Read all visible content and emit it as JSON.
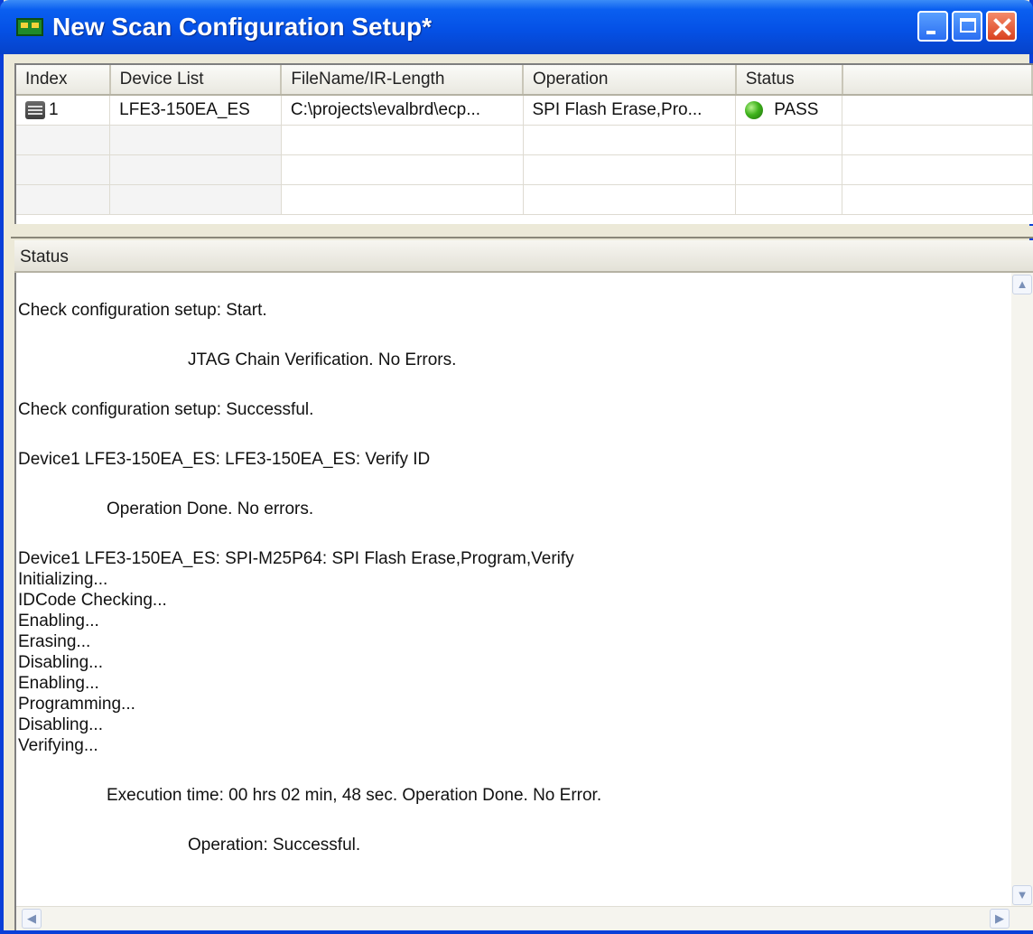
{
  "window": {
    "title": "New Scan Configuration Setup*"
  },
  "grid": {
    "columns": [
      "Index",
      "Device List",
      "FileName/IR-Length",
      "Operation",
      "Status"
    ],
    "rows": [
      {
        "index": "1",
        "device": "LFE3-150EA_ES",
        "file": "C:\\projects\\evalbrd\\ecp...",
        "operation": "SPI Flash Erase,Pro...",
        "status": "PASS"
      }
    ]
  },
  "status_panel": {
    "header": "Status",
    "lines": [
      "Check configuration setup: Start.",
      "JTAG Chain Verification. No Errors.",
      "Check configuration setup: Successful.",
      "Device1 LFE3-150EA_ES: LFE3-150EA_ES: Verify ID",
      "Operation Done. No errors.",
      "Device1 LFE3-150EA_ES: SPI-M25P64: SPI Flash Erase,Program,Verify",
      "Initializing...",
      "IDCode Checking...",
      "Enabling...",
      "Erasing...",
      "Disabling...",
      "Enabling...",
      "Programming...",
      "Disabling...",
      "Verifying...",
      "Execution time: 00 hrs 02 min, 48 sec. Operation Done. No Error.",
      "Operation: Successful."
    ]
  },
  "colors": {
    "titlebar": "#0551e6",
    "pass": "#3fb31c"
  },
  "icons": {
    "app": "chip-board-icon",
    "row": "printer-icon",
    "status": "green-status-dot-icon"
  }
}
